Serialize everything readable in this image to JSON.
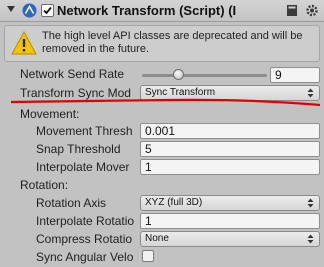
{
  "header": {
    "title": "Network Transform (Script) (I",
    "enabled": true,
    "icons": [
      "fold-arrow-icon",
      "network-component-icon",
      "checkbox-icon",
      "book-help-icon",
      "gear-icon"
    ]
  },
  "warning": {
    "icon": "warning-triangle-icon",
    "text": "The high level API classes are deprecated and will be removed in the future."
  },
  "properties": {
    "send_rate": {
      "label": "Network Send Rate",
      "value": "9",
      "slider_fraction": 0.29
    },
    "sync_mode": {
      "label": "Transform Sync Mod",
      "value": "Sync Transform"
    },
    "movement": {
      "heading": "Movement:",
      "threshold": {
        "label": "Movement Thresh",
        "value": "0.001"
      },
      "snap": {
        "label": "Snap Threshold",
        "value": "5"
      },
      "interpolate": {
        "label": "Interpolate Mover",
        "value": "1"
      }
    },
    "rotation": {
      "heading": "Rotation:",
      "axis": {
        "label": "Rotation Axis",
        "value": "XYZ (full 3D)"
      },
      "interpolate": {
        "label": "Interpolate Rotatio",
        "value": "1"
      },
      "compress": {
        "label": "Compress Rotatio",
        "value": "None"
      },
      "sync_angular": {
        "label": "Sync Angular Velo",
        "checked": false
      }
    }
  },
  "colors": {
    "panel": "#c2c2c2",
    "annotation": "#e00000",
    "warning": "#f5c400"
  }
}
